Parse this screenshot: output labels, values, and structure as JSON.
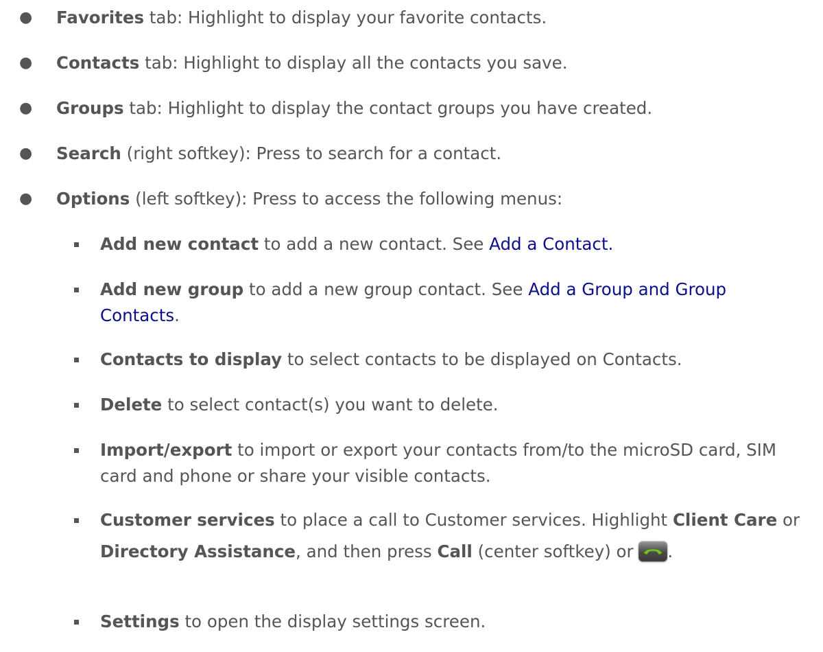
{
  "items": [
    {
      "bold": "Favorites",
      "text": " tab: Highlight to display your favorite contacts."
    },
    {
      "bold": "Contacts",
      "text": " tab: Highlight to display all the contacts you save."
    },
    {
      "bold": "Groups",
      "text": " tab: Highlight to display the contact groups you have created."
    },
    {
      "bold": "Search",
      "text": " (right softkey): Press to search for a contact."
    },
    {
      "bold": "Options",
      "text": " (left softkey): Press to access the following menus:"
    }
  ],
  "subitems": {
    "add_contact": {
      "bold": "Add new contact",
      "text": " to add a new contact. See ",
      "link": "Add a Contact."
    },
    "add_group": {
      "bold": "Add new group",
      "text": " to add a new group contact. See ",
      "link": "Add a Group and Group Contacts",
      "after": "."
    },
    "display": {
      "bold": "Contacts to display",
      "text": " to select contacts to be displayed on Contacts."
    },
    "delete": {
      "bold": "Delete",
      "text": " to select contact(s) you want to delete."
    },
    "import": {
      "bold": "Import/export",
      "text": " to import or export your contacts from/to the microSD card, SIM card and phone or share your visible contacts."
    },
    "customer": {
      "bold": "Customer services",
      "text1": " to place a call to Customer services. Highlight ",
      "bold2": "Client Care",
      "text2": " or ",
      "bold3": "Directory Assistance",
      "text3": ", and then press ",
      "bold4": "Call",
      "text4": " (center softkey) or ",
      "text5": "."
    },
    "settings": {
      "bold": "Settings",
      "text": " to open the display settings screen."
    }
  },
  "icons": {
    "call_key": "call-key-icon"
  },
  "colors": {
    "text": "#555555",
    "link": "#0a0f8a",
    "call_handset": "#7cc52a"
  }
}
